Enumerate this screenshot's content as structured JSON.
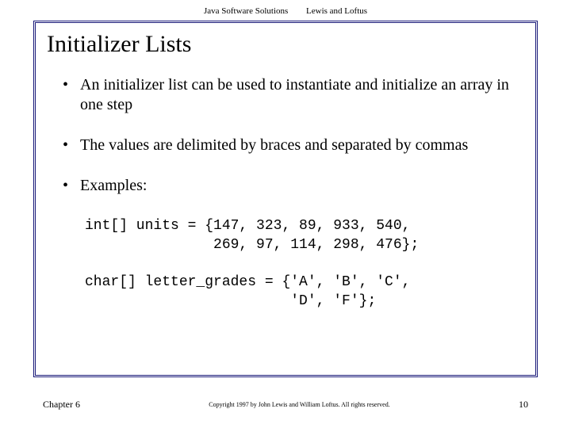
{
  "header": {
    "book_title": "Java Software Solutions",
    "authors": "Lewis and Loftus"
  },
  "slide": {
    "title": "Initializer Lists",
    "bullets": [
      "An initializer list can be used to instantiate and initialize an array in one step",
      "The values are delimited by braces and separated by commas",
      "Examples:"
    ],
    "code1": "int[] units = {147, 323, 89, 933, 540,\n               269, 97, 114, 298, 476};",
    "code2": "char[] letter_grades = {'A', 'B', 'C',\n                        'D', 'F'};"
  },
  "footer": {
    "chapter": "Chapter 6",
    "copyright": "Copyright 1997 by John Lewis and William Loftus. All rights reserved.",
    "page": "10"
  }
}
